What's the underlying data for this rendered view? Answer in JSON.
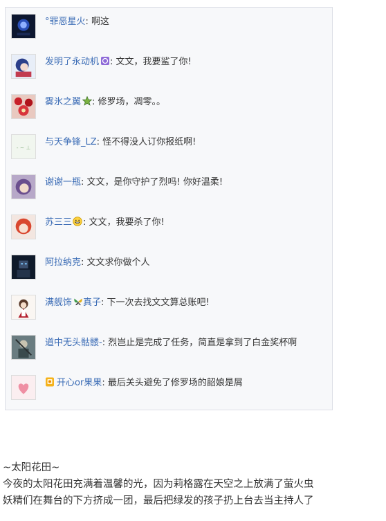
{
  "comments": [
    {
      "user": "°罪恶星火",
      "sep": ": ",
      "text": "啊这",
      "avatar": "dark-blue-orb-avatar"
    },
    {
      "user": "发明了永动机",
      "badge": "purple-level-badge",
      "sep": ": ",
      "text": "文文，我要鲨了你!",
      "avatar": "anime-girl-avatar"
    },
    {
      "user": "雾氷之翼",
      "badge": "green-star-badge",
      "sep": ": ",
      "text": "修罗场，凋零。。",
      "avatar": "red-pattern-avatar"
    },
    {
      "user": "与天争锋_LZ",
      "sep": ": ",
      "text": "怪不得没人订你报纸啊!",
      "avatar": "pale-green-avatar"
    },
    {
      "user": "谢谢一瓶",
      "sep": ": ",
      "text": "文文，是你守护了烈吗! 你好温柔!",
      "avatar": "purple-hair-avatar"
    },
    {
      "user": "苏三三",
      "emoji": "grin-emoji",
      "sep": ": ",
      "text": "文文，我要杀了你!",
      "avatar": "red-hair-avatar"
    },
    {
      "user": "阿拉纳克",
      "sep": ": ",
      "text": "文文求你做个人",
      "avatar": "dark-robot-avatar"
    },
    {
      "user": "满舰饰",
      "badge": "butterfly-badge",
      "user2": "真子",
      "sep": ": ",
      "text": "下一次去找文文算总账吧!",
      "avatar": "maid-character-avatar"
    },
    {
      "user": "道中无头骷髅-",
      "sep": ": ",
      "text": "烈岂止是完成了任务，简直是拿到了白金奖杯啊",
      "avatar": "skeleton-warrior-avatar"
    },
    {
      "user": "开心or果果",
      "prefix_badge": "yellow-vip-badge",
      "sep": ": ",
      "text": "最后关头避免了修罗场的韶娘是屑",
      "avatar": "pink-heart-avatar"
    }
  ],
  "article": {
    "lines": [
      "~太阳花田~",
      "今夜的太阳花田充满着温馨的光，因为莉格露在天空之上放满了萤火虫",
      "妖精们在舞台的下方挤成一团，最后把绿发的孩子扔上台去当主持人了"
    ]
  },
  "colors": {
    "username": "#3a6bb5",
    "text": "#333333",
    "box_bg": "#f7f8fa",
    "box_border": "#dcdfe6"
  }
}
